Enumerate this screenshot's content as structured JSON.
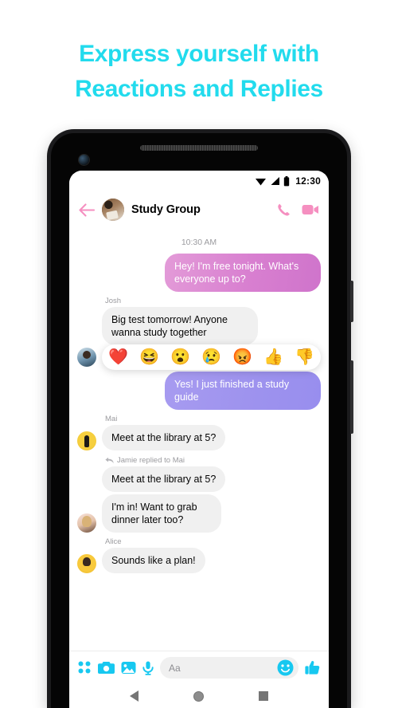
{
  "headline": {
    "line1": "Express yourself with",
    "line2": "Reactions and Replies",
    "color": "#22dbed"
  },
  "status_bar": {
    "time": "12:30",
    "icons": [
      "wifi-icon",
      "cellular-signal-icon",
      "battery-icon"
    ]
  },
  "chat_header": {
    "back_label": "back-arrow",
    "title": "Study Group",
    "avatar_name": "group-avatar",
    "call_icon": "phone-call-icon",
    "video_icon": "video-call-icon",
    "accent_color": "#f799c4"
  },
  "conversation": {
    "timestamp": "10:30 AM",
    "messages": [
      {
        "id": "m1",
        "direction": "out",
        "text": "Hey! I'm free tonight. What's everyone up to?",
        "bubble_style": "g1"
      },
      {
        "id": "m2",
        "direction": "in",
        "sender": "Josh",
        "text": "Big test tomorrow! Anyone wanna study together",
        "avatar": "av-josh"
      },
      {
        "id": "m3",
        "direction": "out",
        "text": "Yes! I just finished a study guide",
        "bubble_style": "g2"
      },
      {
        "id": "m4",
        "direction": "in",
        "sender": "Mai",
        "text": "Meet at the library at 5?",
        "avatar": "av-mai"
      },
      {
        "id": "m5",
        "direction": "in",
        "reply_to": "Jamie replied to Mai",
        "quoted_text": "Meet at the library at 5?",
        "text": "I'm in! Want to grab dinner later too?",
        "avatar": "av-jamie"
      },
      {
        "id": "m6",
        "direction": "in",
        "sender": "Alice",
        "text": "Sounds like a plan!",
        "avatar": "av-alice"
      }
    ],
    "reaction_bar": {
      "target_message": "m2",
      "reactions": [
        {
          "name": "heart-reaction",
          "glyph": "❤️"
        },
        {
          "name": "laugh-reaction",
          "glyph": "😆"
        },
        {
          "name": "wow-reaction",
          "glyph": "😮"
        },
        {
          "name": "sad-reaction",
          "glyph": "😢"
        },
        {
          "name": "angry-reaction",
          "glyph": "😡"
        },
        {
          "name": "thumbs-up-reaction",
          "glyph": "👍"
        },
        {
          "name": "thumbs-down-reaction",
          "glyph": "👎"
        }
      ]
    }
  },
  "composer": {
    "placeholder": "Aa",
    "value": "",
    "accent_color": "#17c8f0",
    "icons": [
      {
        "name": "app-grid-icon"
      },
      {
        "name": "camera-icon"
      },
      {
        "name": "gallery-icon"
      },
      {
        "name": "microphone-icon"
      },
      {
        "name": "emoji-icon"
      },
      {
        "name": "thumbs-up-send-icon"
      }
    ]
  },
  "nav_bar": {
    "back": "android-back-button",
    "home": "android-home-button",
    "recents": "android-recents-button"
  }
}
